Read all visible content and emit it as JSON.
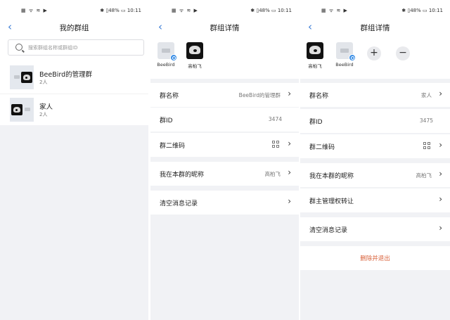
{
  "status": {
    "left": "▦ ᯤ ≋ ▶",
    "right": "✱ ▯48% ▭ 10:11"
  },
  "screen1": {
    "title": "我的群组",
    "search_placeholder": "搜索群组名称或群组ID",
    "groups": [
      {
        "name": "BeeBird的管理群",
        "count": "2人"
      },
      {
        "name": "家人",
        "count": "2人"
      }
    ]
  },
  "screen2": {
    "title": "群组详情",
    "members": [
      {
        "name": "BeeBird"
      },
      {
        "name": "高柏飞"
      }
    ],
    "cells": {
      "name_label": "群名称",
      "name_value": "BeeBird的管理群",
      "id_label": "群ID",
      "id_value": "3474",
      "qr_label": "群二维码",
      "nick_label": "我在本群的昵称",
      "nick_value": "高柏飞",
      "clear_label": "清空消息记录"
    }
  },
  "screen3": {
    "title": "群组详情",
    "members": [
      {
        "name": "高柏飞"
      },
      {
        "name": "BeeBird"
      }
    ],
    "add_symbol": "+",
    "remove_symbol": "−",
    "cells": {
      "name_label": "群名称",
      "name_value": "家人",
      "id_label": "群ID",
      "id_value": "3475",
      "qr_label": "群二维码",
      "nick_label": "我在本群的昵称",
      "nick_value": "高柏飞",
      "transfer_label": "群主管理权转让",
      "clear_label": "清空消息记录",
      "delete_label": "删除并退出"
    }
  },
  "colors": {
    "accent": "#3a7bd5",
    "danger": "#d9623b",
    "background": "#f1f2f5"
  }
}
